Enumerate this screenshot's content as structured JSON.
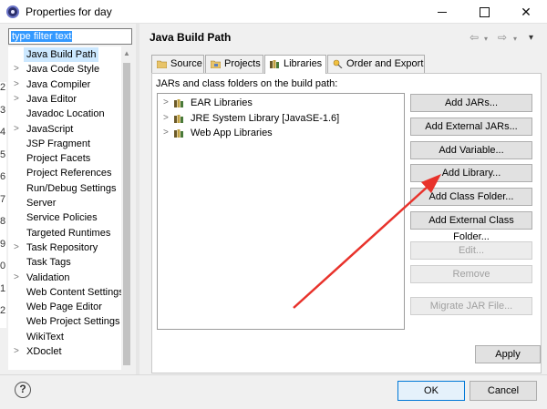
{
  "window": {
    "title": "Properties for day",
    "minimize_icon": "minimize-icon",
    "maximize_icon": "maximize-icon",
    "close_label": "✕"
  },
  "filter": {
    "value": "type filter text"
  },
  "sidebar": {
    "items": [
      {
        "label": "Java Build Path",
        "arrow": "",
        "selected": true
      },
      {
        "label": "Java Code Style",
        "arrow": ">"
      },
      {
        "label": "Java Compiler",
        "arrow": ">"
      },
      {
        "label": "Java Editor",
        "arrow": ">"
      },
      {
        "label": "Javadoc Location",
        "arrow": ""
      },
      {
        "label": "JavaScript",
        "arrow": ">"
      },
      {
        "label": "JSP Fragment",
        "arrow": ""
      },
      {
        "label": "Project Facets",
        "arrow": ""
      },
      {
        "label": "Project References",
        "arrow": ""
      },
      {
        "label": "Run/Debug Settings",
        "arrow": ""
      },
      {
        "label": "Server",
        "arrow": ""
      },
      {
        "label": "Service Policies",
        "arrow": ""
      },
      {
        "label": "Targeted Runtimes",
        "arrow": ""
      },
      {
        "label": "Task Repository",
        "arrow": ">"
      },
      {
        "label": "Task Tags",
        "arrow": ""
      },
      {
        "label": "Validation",
        "arrow": ">"
      },
      {
        "label": "Web Content Settings",
        "arrow": ""
      },
      {
        "label": "Web Page Editor",
        "arrow": ""
      },
      {
        "label": "Web Project Settings",
        "arrow": ""
      },
      {
        "label": "WikiText",
        "arrow": ""
      },
      {
        "label": "XDoclet",
        "arrow": ">"
      }
    ]
  },
  "left_strip": [
    "2",
    "3",
    "4",
    "5",
    "6",
    "7",
    "8",
    "9",
    "0",
    "1",
    "2"
  ],
  "main": {
    "title": "Java Build Path",
    "nav": {
      "back": "⇦",
      "forward": "⇨",
      "menu": "▾"
    },
    "tabs": [
      {
        "label": "Source",
        "icon": "source-folder-icon"
      },
      {
        "label": "Projects",
        "icon": "projects-icon"
      },
      {
        "label": "Libraries",
        "icon": "libraries-icon",
        "active": true
      },
      {
        "label": "Order and Export",
        "icon": "order-export-icon"
      }
    ],
    "jars_label": "JARs and class folders on the build path:",
    "libraries": [
      {
        "label": "EAR Libraries"
      },
      {
        "label": "JRE System Library [JavaSE-1.6]"
      },
      {
        "label": "Web App Libraries"
      }
    ],
    "buttons": {
      "add_jars": "Add JARs...",
      "add_external_jars": "Add External JARs...",
      "add_variable": "Add Variable...",
      "add_library": "Add Library...",
      "add_class_folder": "Add Class Folder...",
      "add_external_class_folder": "Add External Class Folder...",
      "edit": "Edit...",
      "remove": "Remove",
      "migrate_jar": "Migrate JAR File...",
      "apply": "Apply"
    }
  },
  "footer": {
    "help": "?",
    "ok": "OK",
    "cancel": "Cancel"
  },
  "colors": {
    "accent": "#0078d7",
    "selection": "#cce8ff",
    "annotation_arrow": "#e8322b"
  }
}
